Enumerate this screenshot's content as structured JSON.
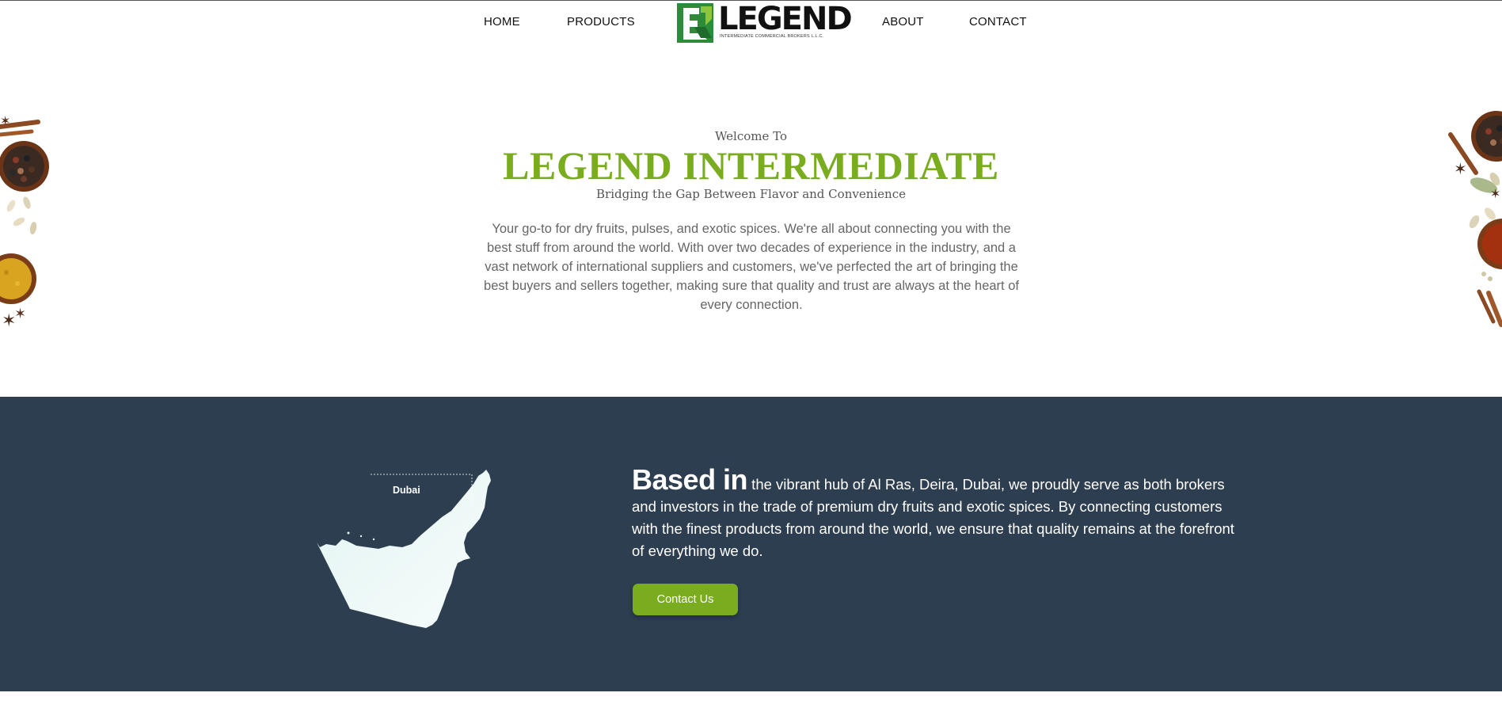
{
  "nav": {
    "home": "HOME",
    "products": "PRODUCTS",
    "about": "ABOUT",
    "contact": "CONTACT"
  },
  "logo": {
    "word": "LEGEND",
    "subtitle": "INTERMEDIATE COMMERCIAL BROKERS L.L.C."
  },
  "hero": {
    "pre_title": "Welcome To",
    "title": "LEGEND INTERMEDIATE",
    "tagline": "Bridging the Gap Between Flavor and Convenience",
    "body": "Your go-to for dry fruits, pulses, and exotic spices. We're all about connecting you with the best stuff from around the world. With over two decades of experience in the industry, and a vast network of international suppliers and customers, we've perfected the art of bringing the best buyers and sellers together, making sure that quality and trust are always at the heart of every connection."
  },
  "about_section": {
    "map_label": "Dubai",
    "lead": "Based in",
    "body": " the vibrant hub of Al Ras, Deira, Dubai, we proudly serve as both brokers and investors in the trade of premium dry fruits and exotic spices. By connecting customers with the finest products from around the world, we ensure that quality remains at the forefront of everything we do.",
    "button": "Contact Us"
  },
  "colors": {
    "accent_green": "#79ad1f",
    "dark_section": "#2d3e50",
    "logo_green": "#2e8b3a"
  }
}
